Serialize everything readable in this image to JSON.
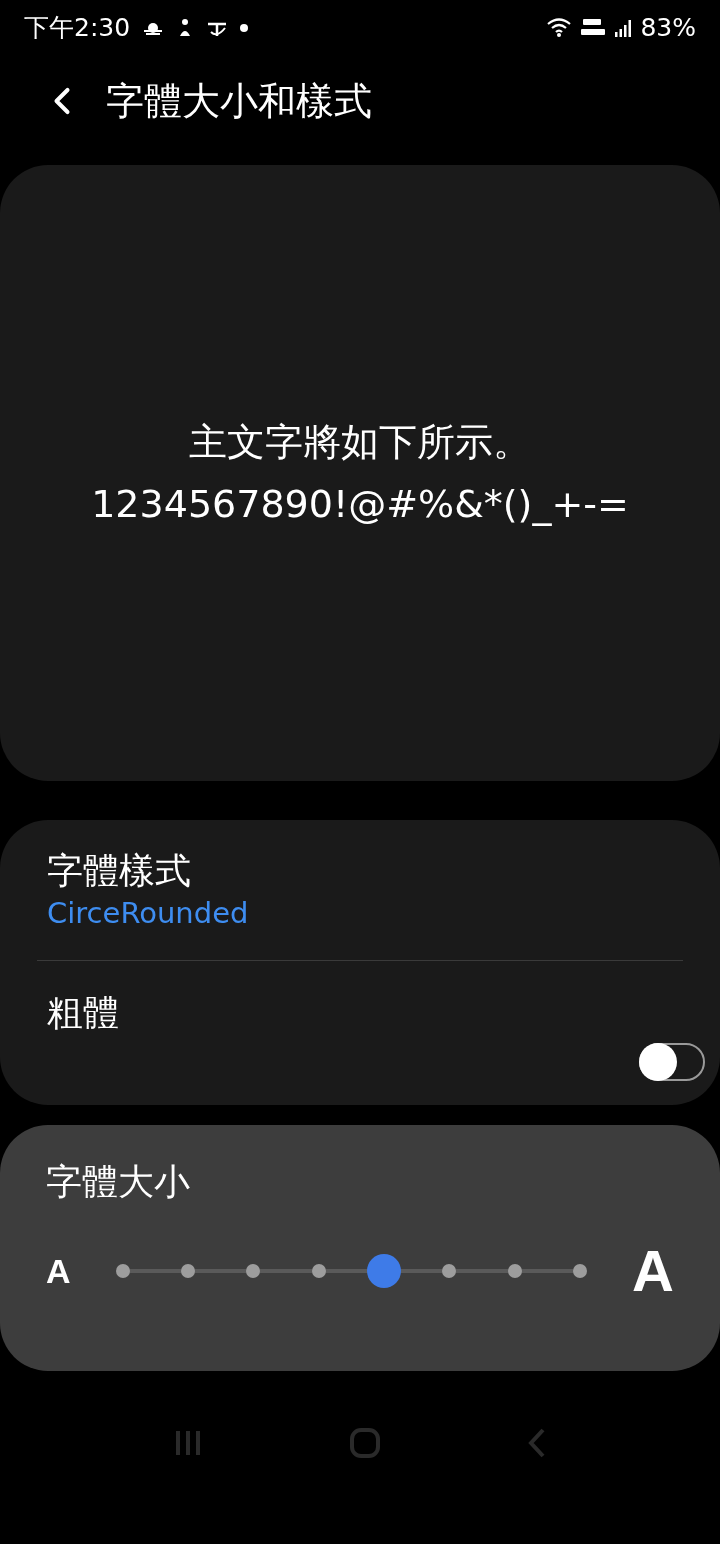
{
  "status_bar": {
    "time": "下午2:30",
    "battery": "83%"
  },
  "header": {
    "title": "字體大小和樣式"
  },
  "preview": {
    "lines": [
      "主文字將如下所示。",
      "1234567890!@#%&*()_+-="
    ]
  },
  "settings": [
    {
      "kind": "value",
      "label": "字體樣式",
      "value": "CirceRounded"
    },
    {
      "kind": "switch",
      "label": "粗體",
      "on": false
    }
  ],
  "font_size": {
    "title": "字體大小",
    "small_label": "A",
    "large_label": "A",
    "level": 0.571
  }
}
